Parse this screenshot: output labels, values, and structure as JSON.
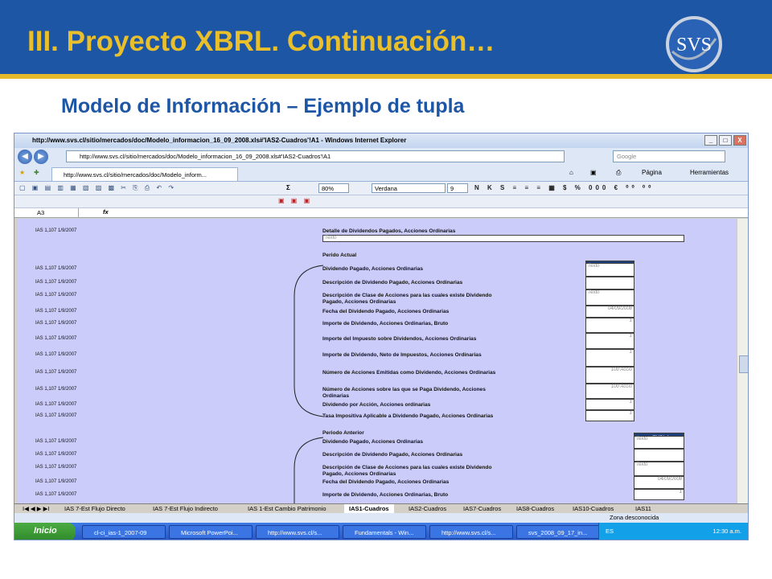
{
  "slide": {
    "title": "III. Proyecto XBRL. Continuación…",
    "subtitle": "Modelo de Información – Ejemplo de tupla",
    "logo_text": "SVS",
    "colors": {
      "title_bar": "#1e56a6",
      "title_text": "#e9bf2c",
      "subtitle_text": "#1e56a6"
    }
  },
  "browser": {
    "window_title": "http://www.svs.cl/sitio/mercados/doc/Modelo_informacion_16_09_2008.xls#'IAS2-Cuadros'!A1 - Windows Internet Explorer",
    "address": "http://www.svs.cl/sitio/mercados/doc/Modelo_informacion_16_09_2008.xls#'IAS2-Cuadros'!A1",
    "search_placeholder": "Google",
    "tab_label": "http://www.svs.cl/sitio/mercados/doc/Modelo_inform...",
    "page_menu": "Página",
    "tools_menu": "Herramientas",
    "window_buttons": {
      "minimize": "_",
      "maximize": "□",
      "close": "X"
    }
  },
  "excel": {
    "zoom": "80%",
    "font": "Verdana",
    "font_size": "9",
    "name_box": "A3",
    "fx": "fx",
    "toolbar_glyphs": "▢ ▣ ▤ ▥ ▦ ▧ ▨ ▩ ✂ ⎘ ⎙ ↶ ↷",
    "format_glyphs": "N K S ≡ ≡ ≡ ▦ $ % 000 € ⁰⁰ ⁰⁰",
    "pdf_buttons": "▣ ▣ ▣",
    "sigma": "Σ"
  },
  "sheet": {
    "detalle": {
      "ref": "IAS 1,107 1/9/2007",
      "label": "Detalle de Dividendos Pagados, Acciones Ordinarias",
      "input": "Texto"
    },
    "actual": {
      "section": "Perido Actual",
      "tupla_header": "+ TUPLA",
      "rows": [
        {
          "ref": "IAS 1,107 1/9/2007",
          "label": "Dividendo Pagado, Acciones Ordinarias",
          "input": "Texto"
        },
        {
          "ref": "IAS 1,107 1/9/2007",
          "label": "Descripción de Dividendo Pagado, Acciones Ordinarias",
          "input": ""
        },
        {
          "ref": "IAS 1,107 1/9/2007",
          "label": "Descripción de Clase de Acciones para las cuales existe Dividendo",
          "label2": "Pagado, Acciones Ordinarias",
          "input": "Texto"
        },
        {
          "ref": "IAS 1,107 1/9/2007",
          "label": "Fecha del Dividendo Pagado, Acciones Ordinarias",
          "input": "04/09/2008"
        },
        {
          "ref": "IAS 1,107 1/9/2007",
          "label": "Importe de Dividendo, Acciones Ordinarias, Bruto",
          "input": "1"
        },
        {
          "ref": "IAS 1,107 1/9/2007",
          "label": "Importe del Impuesto sobre Dividendos, Acciones Ordinarias",
          "input": "1"
        },
        {
          "ref": "IAS 1,107 1/9/2007",
          "label": "Importe de Dividendo, Neto de Impuestos, Acciones Ordinarias",
          "input": "1"
        },
        {
          "ref": "IAS 1,107 1/9/2007",
          "label": "Número de Acciones Emitidas como Dividendo, Acciones Ordinarias",
          "input": "100 Accio"
        },
        {
          "ref": "IAS 1,107 1/9/2007",
          "label": "Número de Acciones sobre las que se Paga Dividendo, Acciones",
          "label2": "Ordinarias",
          "input": "100 Accio"
        },
        {
          "ref": "IAS 1,107 1/9/2007",
          "label": "Dividendo por Acción, Acciones ordinarias",
          "input": "1"
        },
        {
          "ref": "IAS 1,107 1/9/2007",
          "label": "Tasa Impositiva Aplicable a Dividendo Pagado, Acciones Ordinarias",
          "input": "1"
        }
      ]
    },
    "anterior": {
      "section": "Periodo Anterior",
      "tupla_header": "+ TUPLA",
      "rows": [
        {
          "ref": "IAS 1,107 1/9/2007",
          "label": "Dividendo Pagado, Acciones Ordinarias",
          "input": "Texto"
        },
        {
          "ref": "IAS 1,107 1/9/2007",
          "label": "Descripción de Dividendo Pagado, Acciones Ordinarias",
          "input": ""
        },
        {
          "ref": "IAS 1,107 1/9/2007",
          "label": "Descripción de Clase de Acciones para las cuales existe Dividendo",
          "label2": "Pagado, Acciones Ordinarias",
          "input": "Texto"
        },
        {
          "ref": "IAS 1,107 1/9/2007",
          "label": "Fecha del Dividendo Pagado, Acciones Ordinarias",
          "input": "04/09/2008"
        },
        {
          "ref": "IAS 1,107 1/9/2007",
          "label": "Importe de Dividendo, Acciones Ordinarias, Bruto",
          "input": "1"
        }
      ]
    }
  },
  "sheet_tabs": [
    "IAS 7-Est Flujo Directo",
    "IAS 7-Est Flujo Indirecto",
    "IAS 1-Est Cambio Patrimonio",
    "IAS1-Cuadros",
    "IAS2-Cuadros",
    "IAS7-Cuadros",
    "IAS8-Cuadros",
    "IAS10-Cuadros",
    "IAS11"
  ],
  "active_sheet_tab": "IAS1-Cuadros",
  "sheet_tab_nav": "I◀ ◀ ▶ ▶I",
  "status": {
    "zone": "Zona desconocida"
  },
  "taskbar": {
    "start": "Inicio",
    "tasks": [
      "cl-ci_ias-1_2007-09",
      "Microsoft PowerPoi...",
      "http://www.svs.cl/s...",
      "Fundamentals - Win...",
      "http://www.svs.cl/s...",
      "svs_2008_09_17_in..."
    ],
    "lang": "ES",
    "clock": "12:30 a.m."
  }
}
